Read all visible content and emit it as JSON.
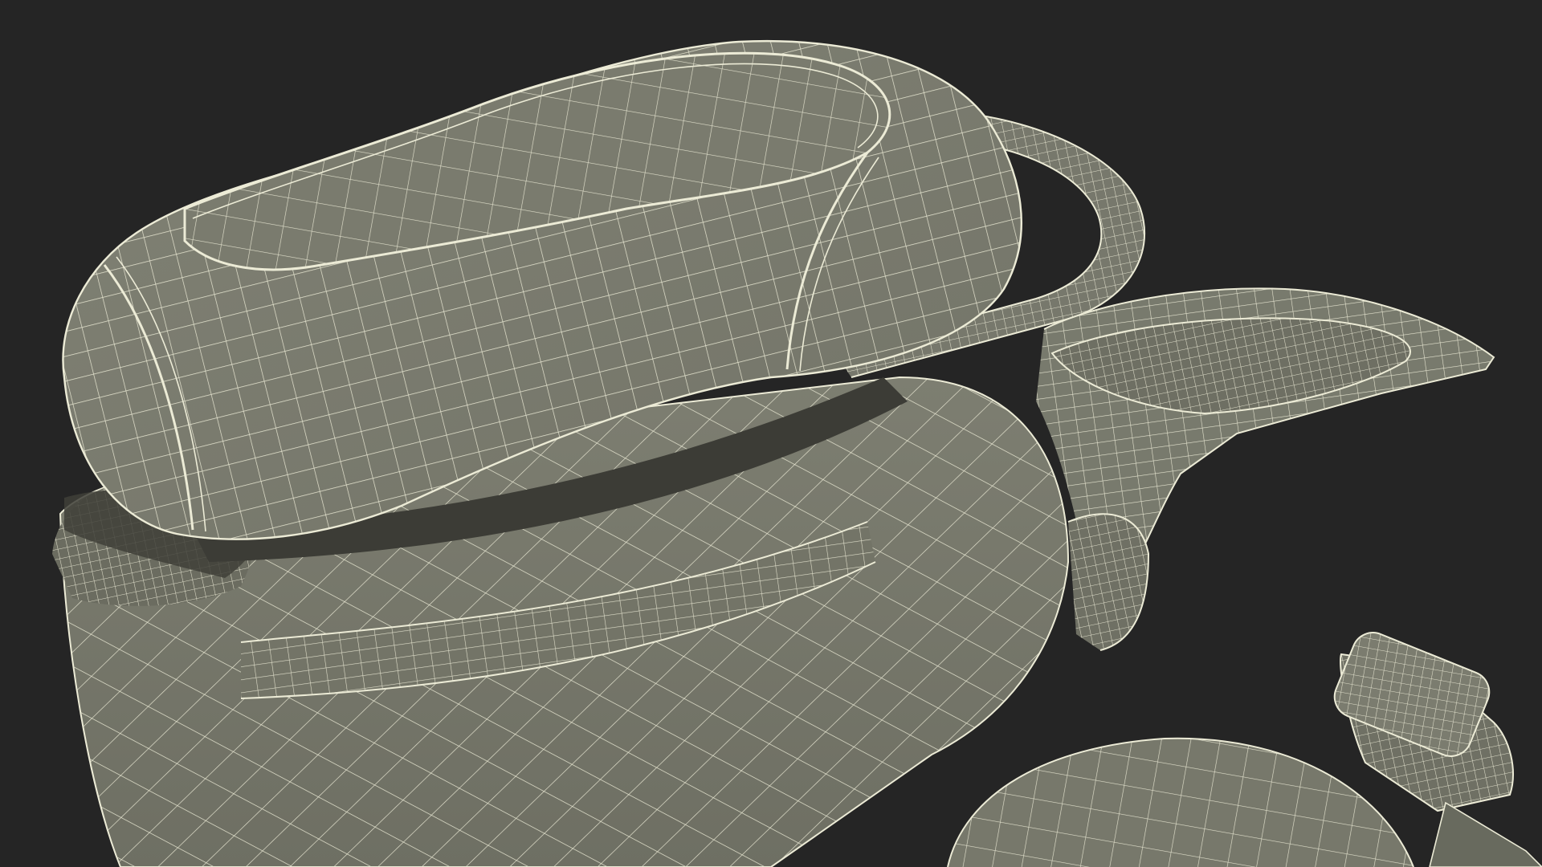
{
  "scene": {
    "subject": "scooter-seat-wireframe",
    "colors": {
      "background": "#252525",
      "surface": "#7c7d70",
      "surface_dark": "#64655a",
      "shadow": "#44443d",
      "wire": "#ecebd6"
    }
  }
}
